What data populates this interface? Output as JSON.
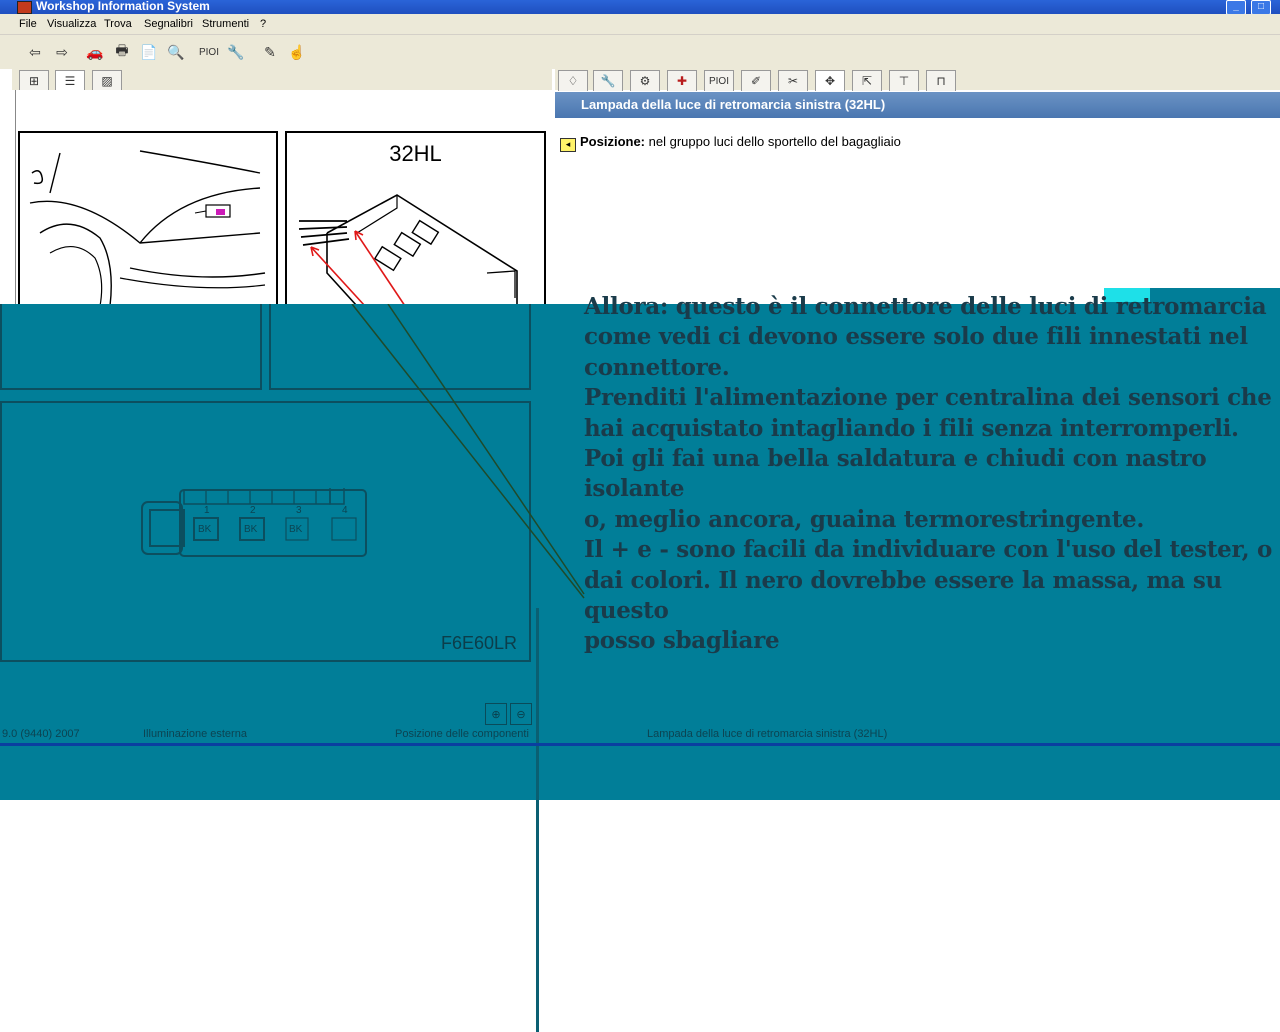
{
  "window": {
    "title": "Workshop Information System",
    "min_glyph": "_",
    "max_glyph": "□",
    "close_glyph": "×"
  },
  "menu": {
    "items": [
      "File",
      "Visualizza",
      "Trova",
      "Segnalibri",
      "Strumenti",
      "?"
    ]
  },
  "toolbar": {
    "buttons": [
      {
        "icon": "back-arrow-icon",
        "glyph": "⇦"
      },
      {
        "icon": "forward-arrow-icon",
        "glyph": "⇨"
      },
      {
        "icon": "car-icon",
        "glyph": "🚗"
      },
      {
        "icon": "print-icon",
        "glyph": "🖶"
      },
      {
        "icon": "document-export-icon",
        "glyph": "📄"
      },
      {
        "icon": "binoculars-icon",
        "glyph": "🔍"
      },
      {
        "icon": "pioi-label",
        "glyph": "PIOI"
      },
      {
        "icon": "tool-icon",
        "glyph": "🔧"
      },
      {
        "icon": "pencil-icon",
        "glyph": "✎"
      },
      {
        "icon": "pointer-icon",
        "glyph": "☝"
      }
    ]
  },
  "left_tabs": [
    {
      "icon": "tree-view-icon",
      "glyph": "⊞"
    },
    {
      "icon": "list-view-icon",
      "glyph": "☰"
    },
    {
      "icon": "image-view-icon",
      "glyph": "▨"
    }
  ],
  "right_tabs": [
    {
      "icon": "component-icon",
      "glyph": "♢"
    },
    {
      "icon": "wrench-icon",
      "glyph": "🔧"
    },
    {
      "icon": "gear-icon",
      "glyph": "⚙"
    },
    {
      "icon": "medical-icon",
      "glyph": "✚"
    },
    {
      "icon": "pioi-tab",
      "glyph": "PIOI"
    },
    {
      "icon": "screwdriver-icon",
      "glyph": "✐"
    },
    {
      "icon": "tools-icon",
      "glyph": "✂"
    },
    {
      "icon": "move-icon",
      "glyph": "✥"
    },
    {
      "icon": "lift-icon",
      "glyph": "⇱"
    },
    {
      "icon": "diagram-icon",
      "glyph": "⊤"
    },
    {
      "icon": "jack-icon",
      "glyph": "⊓"
    }
  ],
  "component": {
    "header": "Lampada della luce di retromarcia sinistra (32HL)",
    "position_label": "Posizione:",
    "position_value": "nel gruppo luci dello sportello del bagagliaio",
    "connector_code": "32HL",
    "figure_code": "F6E60LR",
    "pins": [
      {
        "num": "1",
        "color": "BK"
      },
      {
        "num": "2",
        "color": "BK"
      },
      {
        "num": "3",
        "color": "BK"
      },
      {
        "num": "4",
        "color": ""
      }
    ]
  },
  "handwritten_note": "Allora: questo è il connettore delle luci di retromarcia\ncome vedi ci devono essere solo due fili innestati nel\nconnettore.\nPrenditi l'alimentazione per centralina dei sensori che\nhai acquistato intagliando i fili senza interromperli.\nPoi gli fai una bella saldatura e chiudi con nastro isolante\no, meglio ancora, guaina termorestringente.\nIl + e - sono facili da individuare con l'uso del tester, o\ndai colori. Il nero dovrebbe essere la massa, ma su questo\nposso sbagliare",
  "statusbar": {
    "version": "9.0 (9440) 2007",
    "section": "Illuminazione esterna",
    "view": "Posizione delle componenti",
    "component": "Lampada della luce di retromarcia sinistra (32HL)"
  },
  "colors": {
    "overlay": "#017e98",
    "titlebar": "#2a64d8",
    "header": "#5a84ba",
    "annotation_line": "#1f4a2a"
  }
}
